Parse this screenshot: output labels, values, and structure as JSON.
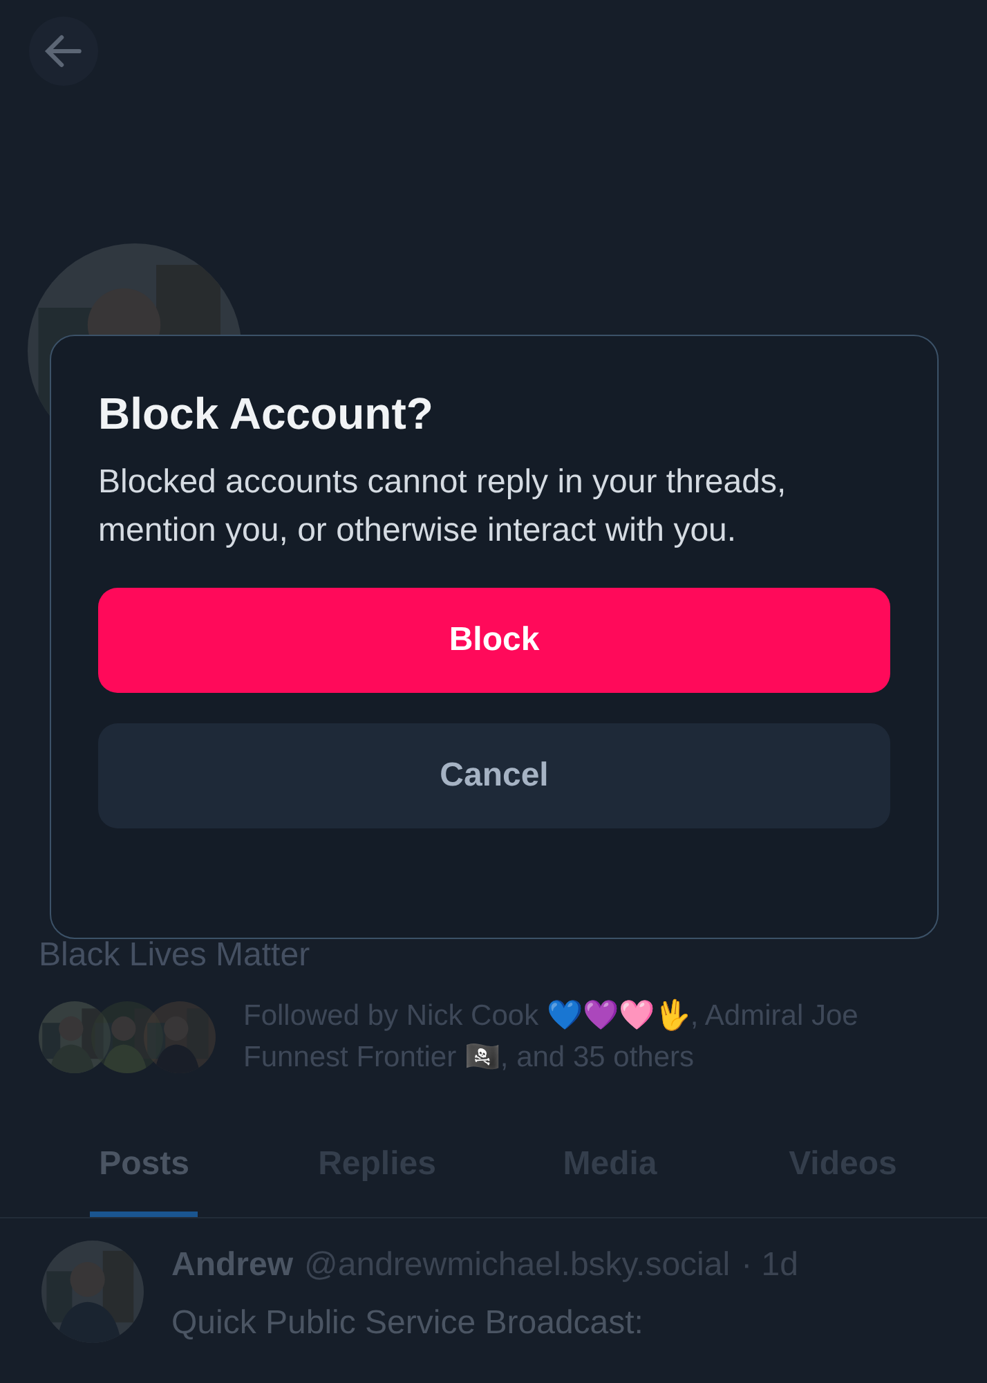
{
  "profile": {
    "bio_last_line": "Black Lives Matter",
    "followed_by": "Followed by Nick Cook 💙💜🩷🖖, Admiral Joe Funnest Frontier 🏴‍☠️, and 35 others"
  },
  "tabs": [
    {
      "label": "Posts",
      "selected": true
    },
    {
      "label": "Replies",
      "selected": false
    },
    {
      "label": "Media",
      "selected": false
    },
    {
      "label": "Videos",
      "selected": false
    }
  ],
  "post": {
    "author": "Andrew",
    "handle": "@andrewmichael.bsky.social",
    "time": "· 1d",
    "text": "Quick Public Service Broadcast:"
  },
  "dialog": {
    "title": "Block Account?",
    "message": "Blocked accounts cannot reply in your threads, mention you, or otherwise interact with you.",
    "buttons": [
      {
        "label": "Block",
        "kind": "danger"
      },
      {
        "label": "Cancel",
        "kind": "secondary"
      }
    ]
  }
}
